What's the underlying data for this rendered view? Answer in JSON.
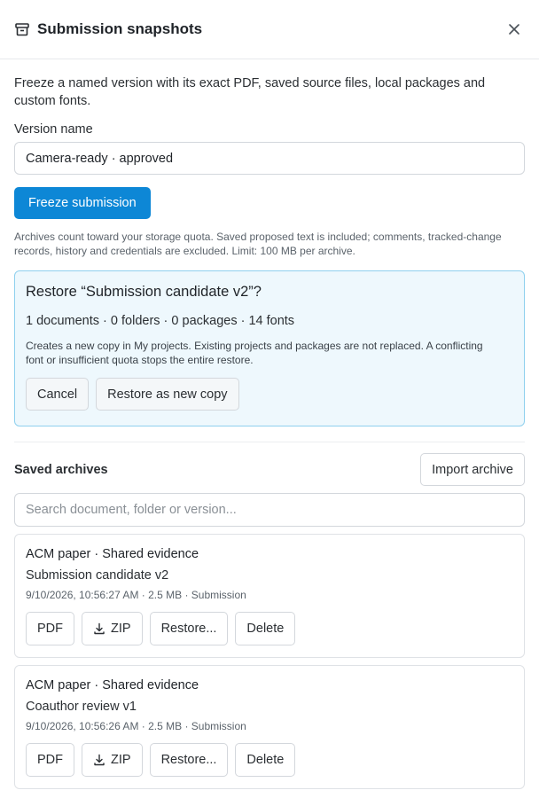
{
  "dialog": {
    "title": "Submission snapshots",
    "title_icon": "archive-box-icon",
    "close_icon": "close-icon"
  },
  "intro": "Freeze a named version with its exact PDF, saved source files, local packages and custom fonts.",
  "version_field": {
    "label": "Version name",
    "value": "Camera-ready · approved"
  },
  "freeze_button": "Freeze submission",
  "quota_note": "Archives count toward your storage quota. Saved proposed text is included; comments, tracked-change records, history and credentials are excluded. Limit: 100 MB per archive.",
  "restore": {
    "title": "Restore “Submission candidate v2”?",
    "stats": "1 documents · 0 folders · 0 packages · 14 fonts",
    "description": "Creates a new copy in My projects. Existing projects and packages are not replaced. A conflicting font or insufficient quota stops the entire restore.",
    "cancel_label": "Cancel",
    "confirm_label": "Restore as new copy"
  },
  "archives": {
    "title": "Saved archives",
    "import_label": "Import archive",
    "search_placeholder": "Search document, folder or version...",
    "items": [
      {
        "document": "ACM paper · Shared evidence",
        "version": "Submission candidate v2",
        "meta": "9/10/2026, 10:56:27 AM · 2.5 MB · Submission",
        "actions": {
          "pdf": "PDF",
          "zip": "ZIP",
          "restore": "Restore...",
          "delete": "Delete"
        }
      },
      {
        "document": "ACM paper · Shared evidence",
        "version": "Coauthor review v1",
        "meta": "9/10/2026, 10:56:26 AM · 2.5 MB · Submission",
        "actions": {
          "pdf": "PDF",
          "zip": "ZIP",
          "restore": "Restore...",
          "delete": "Delete"
        }
      }
    ]
  },
  "colors": {
    "primary": "#0d87d6",
    "panel_bg": "#eef8fd",
    "panel_border": "#8fd0ee"
  }
}
